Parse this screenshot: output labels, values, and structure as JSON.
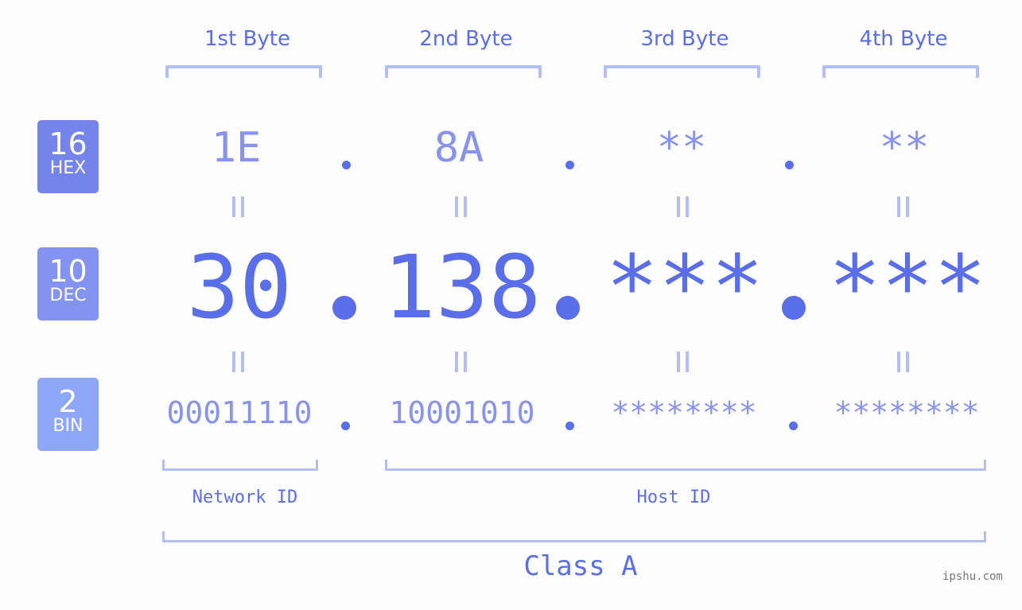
{
  "bytes": [
    {
      "label": "1st Byte",
      "hex": "1E",
      "dec": "30",
      "bin": "00011110"
    },
    {
      "label": "2nd Byte",
      "hex": "8A",
      "dec": "138",
      "bin": "10001010"
    },
    {
      "label": "3rd Byte",
      "hex": "**",
      "dec": "***",
      "bin": "********"
    },
    {
      "label": "4th Byte",
      "hex": "**",
      "dec": "***",
      "bin": "********"
    }
  ],
  "bases": {
    "hex": {
      "num": "16",
      "label": "HEX",
      "color": "#7584ea"
    },
    "dec": {
      "num": "10",
      "label": "DEC",
      "color": "#8492f0"
    },
    "bin": {
      "num": "2",
      "label": "BIN",
      "color": "#8fa7f8"
    }
  },
  "segments": {
    "network": "Network ID",
    "host": "Host ID"
  },
  "class_label": "Class A",
  "watermark": "ipshu.com",
  "colors": {
    "accent": "#5a6ee9",
    "light": "#8793ee",
    "bracket": "#b3bdf7"
  }
}
